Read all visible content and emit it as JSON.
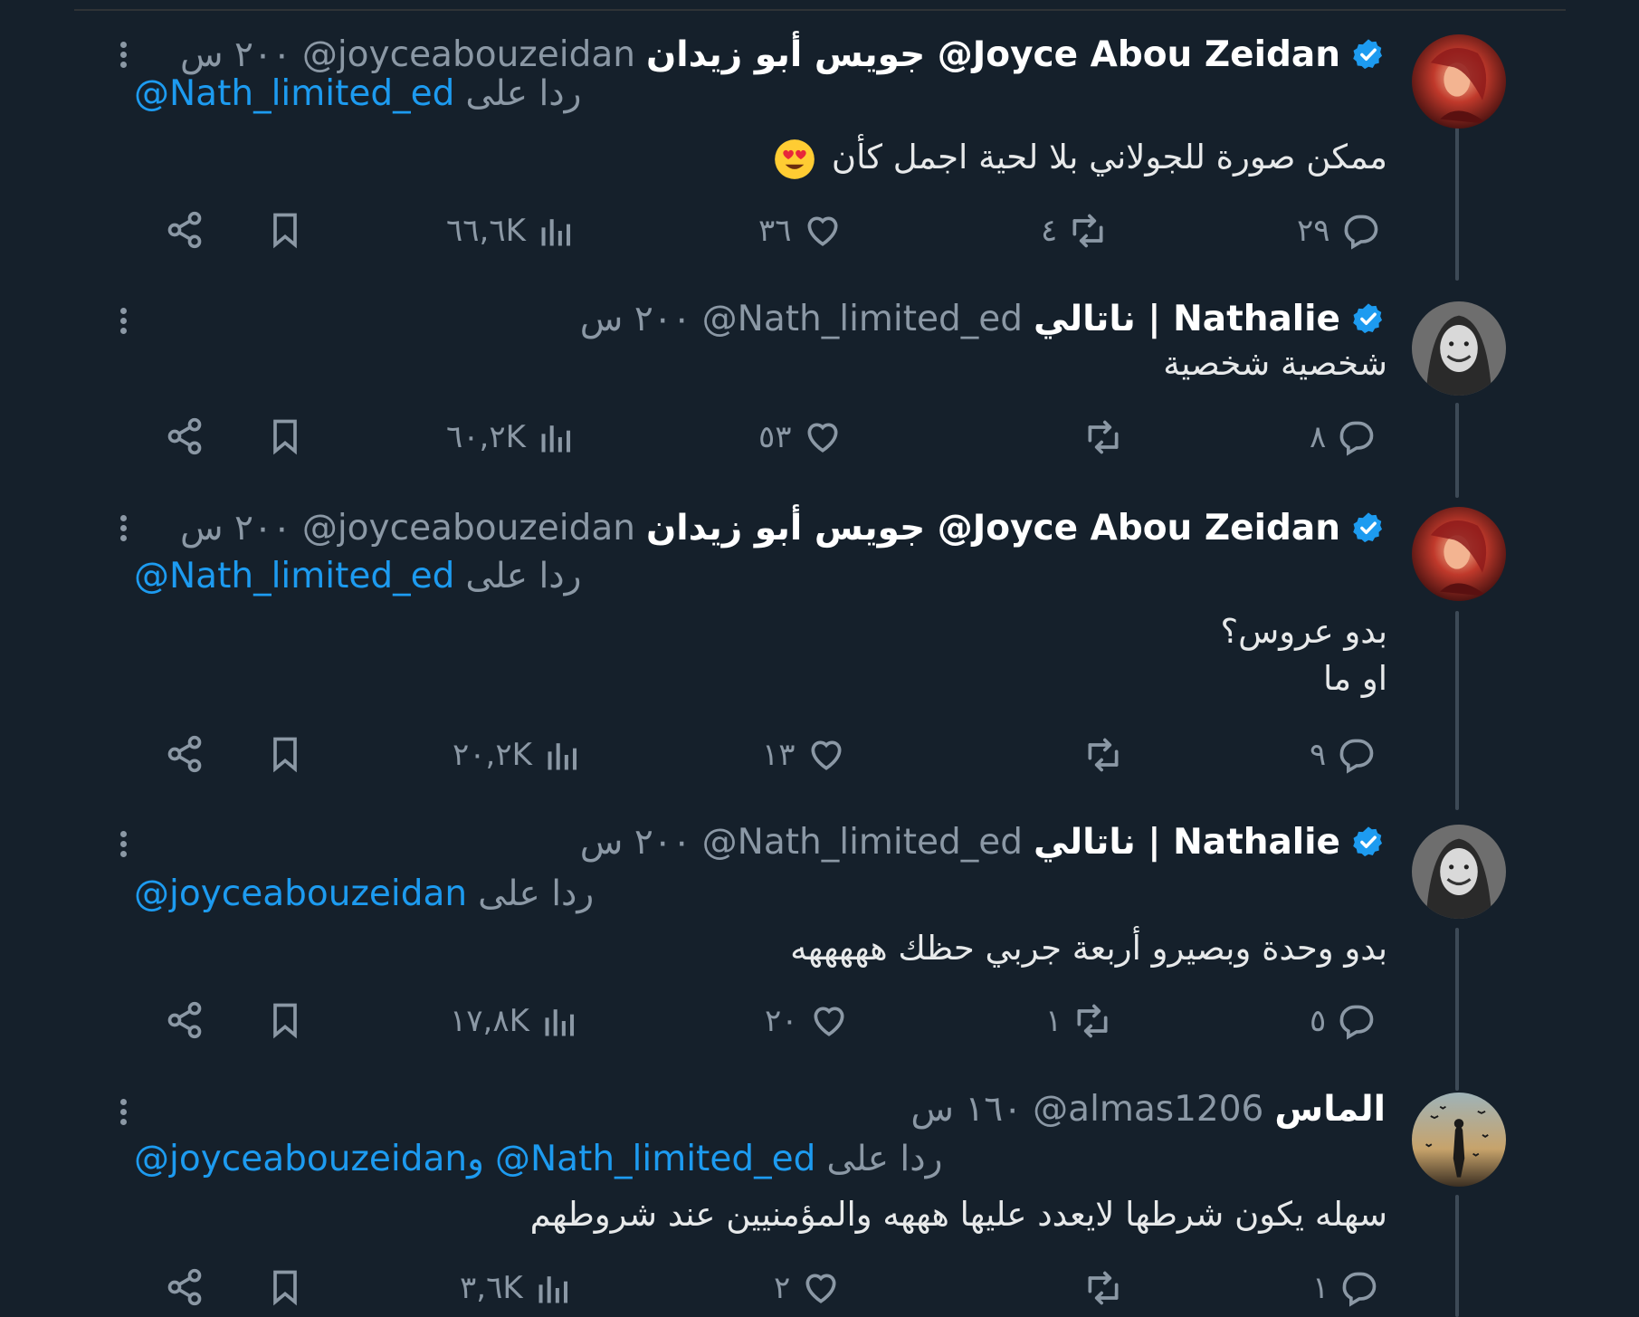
{
  "colors": {
    "bg": "#15202b",
    "text": "#e7e9ea",
    "muted": "#8b98a5",
    "link": "#1d9bf0",
    "verified": "#1d9bf0"
  },
  "tweets": [
    {
      "name": "جويس أبو زيدان @Joyce Abou Zeidan",
      "handle": "@joyceabouzeidan",
      "time": "٢٠٠ س",
      "verified": true,
      "reply_label": "ردا على",
      "reply_to": "@Nath_limited_ed",
      "text_lines": [
        "ممكن صورة للجولاني بلا لحية اجمل كأن"
      ],
      "emoji": "heart-eyes",
      "replies": "٢٩",
      "retweets": "٤",
      "likes": "٣٦",
      "views": "٦٦,٦K",
      "avatar": "red-portrait"
    },
    {
      "name": "ناتالي | Nathalie",
      "handle": "@Nath_limited_ed",
      "time": "٢٠٠ س",
      "verified": true,
      "reply_label": "",
      "reply_to": "",
      "text_lines": [
        "شخصية شخصية"
      ],
      "replies": "٨",
      "retweets": "",
      "likes": "٥٣",
      "views": "٦٠,٢K",
      "avatar": "bw-portrait"
    },
    {
      "name": "جويس أبو زيدان @Joyce Abou Zeidan",
      "handle": "@joyceabouzeidan",
      "time": "٢٠٠ س",
      "verified": true,
      "reply_label": "ردا على",
      "reply_to": "@Nath_limited_ed",
      "text_lines": [
        "بدو عروس؟",
        "او ما"
      ],
      "replies": "٩",
      "retweets": "",
      "likes": "١٣",
      "views": "٢٠,٢K",
      "avatar": "red-portrait"
    },
    {
      "name": "ناتالي | Nathalie",
      "handle": "@Nath_limited_ed",
      "time": "٢٠٠ س",
      "verified": true,
      "reply_label": "ردا على",
      "reply_to": "@joyceabouzeidan",
      "text_lines": [
        "بدو وحدة وبصيرو أربعة جربي حظك هههههه"
      ],
      "replies": "٥",
      "retweets": "١",
      "likes": "٢٠",
      "views": "١٧,٨K",
      "avatar": "bw-portrait"
    },
    {
      "name": "الماس",
      "handle": "@almas1206",
      "time": "١٦٠ س",
      "verified": false,
      "reply_label": "ردا على",
      "reply_to": "@Nath_limited_ed",
      "reply_to_2": "@joyceabouzeidanو",
      "text_lines": [
        "سهله يكون شرطها لايعدد عليها هههه والمؤمنيين عند شروطهم"
      ],
      "replies": "١",
      "retweets": "",
      "likes": "٢",
      "views": "٣,٦K",
      "avatar": "silhouette-birds"
    }
  ]
}
